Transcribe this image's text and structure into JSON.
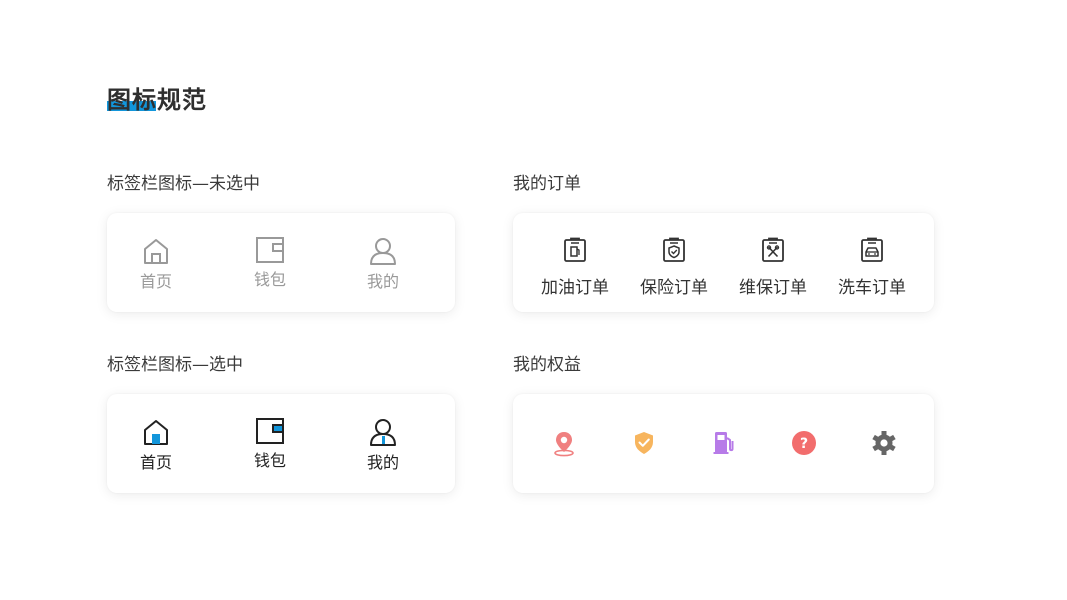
{
  "header": {
    "title": "图标规范"
  },
  "sections": {
    "tab_unselected": {
      "label": "标签栏图标—未选中",
      "items": [
        {
          "label": "首页",
          "icon": "home-icon"
        },
        {
          "label": "钱包",
          "icon": "wallet-icon"
        },
        {
          "label": "我的",
          "icon": "user-icon"
        }
      ],
      "color": "#999999"
    },
    "tab_selected": {
      "label": "标签栏图标—选中",
      "items": [
        {
          "label": "首页",
          "icon": "home-icon"
        },
        {
          "label": "钱包",
          "icon": "wallet-icon"
        },
        {
          "label": "我的",
          "icon": "user-icon"
        }
      ],
      "color": "#222222",
      "accent": "#1296db"
    },
    "my_orders": {
      "label": "我的订单",
      "items": [
        {
          "label": "加油订单",
          "icon": "fuel-order-icon"
        },
        {
          "label": "保险订单",
          "icon": "insurance-order-icon"
        },
        {
          "label": "维保订单",
          "icon": "maintenance-order-icon"
        },
        {
          "label": "洗车订单",
          "icon": "carwash-order-icon"
        }
      ]
    },
    "my_benefits": {
      "label": "我的权益",
      "items": [
        {
          "icon": "location-icon",
          "color": "#f08080"
        },
        {
          "icon": "shield-check-icon",
          "color": "#f7b55e"
        },
        {
          "icon": "gas-pump-icon",
          "color": "#b77be8"
        },
        {
          "icon": "help-icon",
          "color": "#f26d6d"
        },
        {
          "icon": "gear-icon",
          "color": "#666666"
        }
      ]
    }
  }
}
